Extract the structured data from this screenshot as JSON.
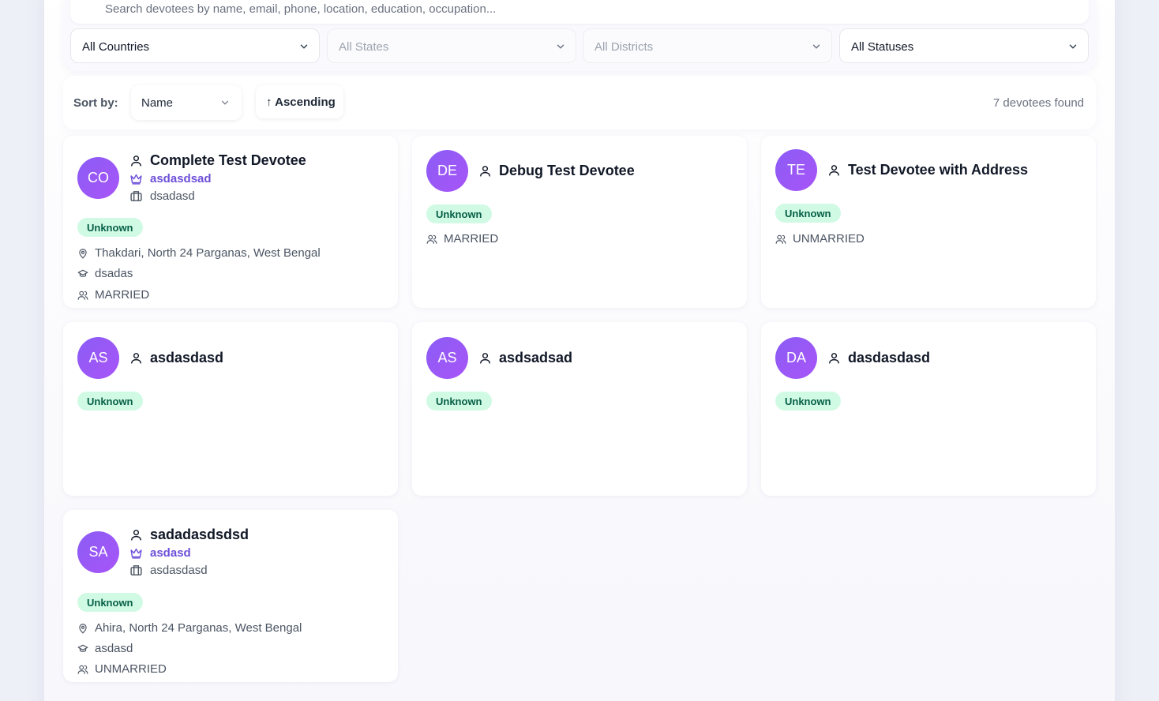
{
  "search": {
    "placeholder": "Search devotees by name, email, phone, location, education, occupation..."
  },
  "filters": {
    "country": "All Countries",
    "state": "All States",
    "district": "All Districts",
    "status": "All Statuses"
  },
  "sort": {
    "label": "Sort by:",
    "field": "Name",
    "order": "↑ Ascending",
    "results_count": "7 devotees found"
  },
  "colors": {
    "avatar": "#8b5cf6",
    "badge_bg": "#d1fae5",
    "badge_text": "#065f46",
    "spiritual_text": "#6d4fd8"
  },
  "devotees": [
    {
      "initials": "CO",
      "name": "Complete Test Devotee",
      "spiritual_master": "asdasdsad",
      "occupation": "dsadasd",
      "status": "Unknown",
      "location": "Thakdari, North 24 Parganas, West Bengal",
      "education": "dsadas",
      "marital": "MARRIED"
    },
    {
      "initials": "DE",
      "name": "Debug Test Devotee",
      "status": "Unknown",
      "marital": "MARRIED"
    },
    {
      "initials": "TE",
      "name": "Test Devotee with Address",
      "status": "Unknown",
      "marital": "UNMARRIED"
    },
    {
      "initials": "AS",
      "name": "asdasdasd",
      "status": "Unknown"
    },
    {
      "initials": "AS",
      "name": "asdsadsad",
      "status": "Unknown"
    },
    {
      "initials": "DA",
      "name": "dasdasdasd",
      "status": "Unknown"
    },
    {
      "initials": "SA",
      "name": "sadadasdsdsd",
      "spiritual_master": "asdasd",
      "occupation": "asdasdasd",
      "status": "Unknown",
      "location": "Ahira, North 24 Parganas, West Bengal",
      "education": "asdasd",
      "marital": "UNMARRIED"
    }
  ]
}
